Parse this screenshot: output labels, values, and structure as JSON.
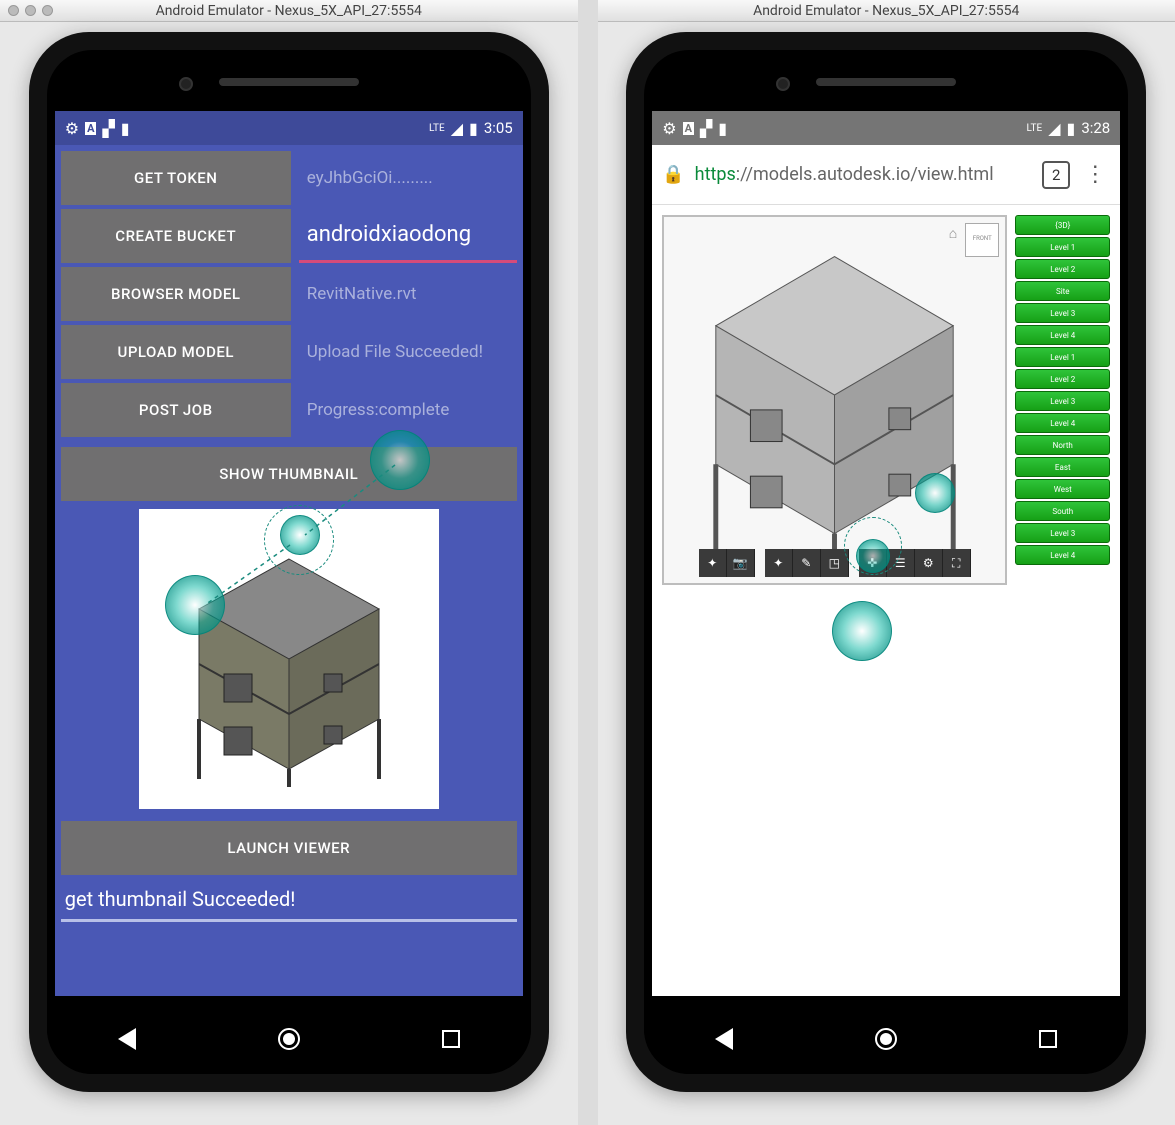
{
  "window_title": "Android Emulator - Nexus_5X_API_27:5554",
  "left": {
    "clock": "3:05",
    "lte": "LTE",
    "buttons": {
      "get_token": "GET TOKEN",
      "create_bucket": "CREATE BUCKET",
      "browser_model": "BROWSER MODEL",
      "upload_model": "UPLOAD MODEL",
      "post_job": "POST JOB",
      "show_thumbnail": "SHOW THUMBNAIL",
      "launch_viewer": "LAUNCH VIEWER"
    },
    "values": {
      "token": "eyJhbGciOi.........",
      "bucket_name": "androidxiaodong",
      "model_file": "RevitNative.rvt",
      "upload_status": "Upload File Succeeded!",
      "job_status": "Progress:complete"
    },
    "status_message": "get thumbnail Succeeded!"
  },
  "right": {
    "clock": "3:28",
    "lte": "LTE",
    "url_https": "https",
    "url_rest": "://models.autodesk.io/view.html",
    "tab_count": "2",
    "tree": [
      "{3D}",
      "Level 1",
      "Level 2",
      "Site",
      "Level 3",
      "Level 4",
      "Level 1",
      "Level 2",
      "Level 3",
      "Level 4",
      "North",
      "East",
      "West",
      "South",
      "Level 3",
      "Level 4"
    ]
  }
}
